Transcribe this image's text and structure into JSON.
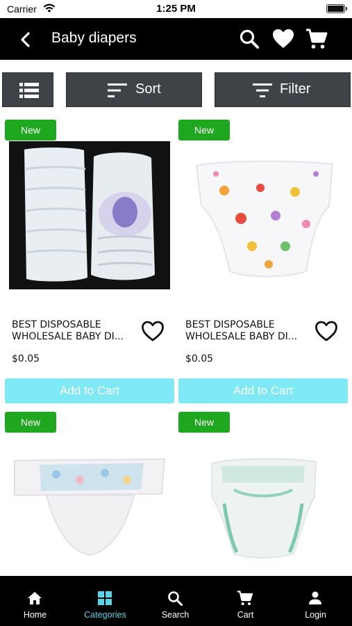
{
  "status_bar": {
    "carrier": "Carrier",
    "time": "1:25 PM"
  },
  "header": {
    "title": "Baby diapers"
  },
  "toolbar": {
    "sort_label": "Sort",
    "filter_label": "Filter"
  },
  "products": [
    {
      "badge": "New",
      "name_line1": "BEST DISPOSABLE",
      "name_line2": "WHOLESALE BABY DI...",
      "price": "$0.05",
      "add_label": "Add to Cart"
    },
    {
      "badge": "New",
      "name_line1": "BEST DISPOSABLE",
      "name_line2": "WHOLESALE BABY DI...",
      "price": "$0.05",
      "add_label": "Add to Cart"
    },
    {
      "badge": "New"
    },
    {
      "badge": "New"
    }
  ],
  "tabs": [
    {
      "label": "Home",
      "icon": "home-icon"
    },
    {
      "label": "Categories",
      "icon": "grid-icon",
      "active": true
    },
    {
      "label": "Search",
      "icon": "search-icon"
    },
    {
      "label": "Cart",
      "icon": "cart-icon"
    },
    {
      "label": "Login",
      "icon": "person-icon"
    }
  ],
  "colors": {
    "header_bg": "#000000",
    "badge_green": "#1fa81f",
    "add_cart_bg": "#7fe9f6",
    "toolbar_bg": "#3f4246",
    "active_tab": "#5ad4e6"
  }
}
